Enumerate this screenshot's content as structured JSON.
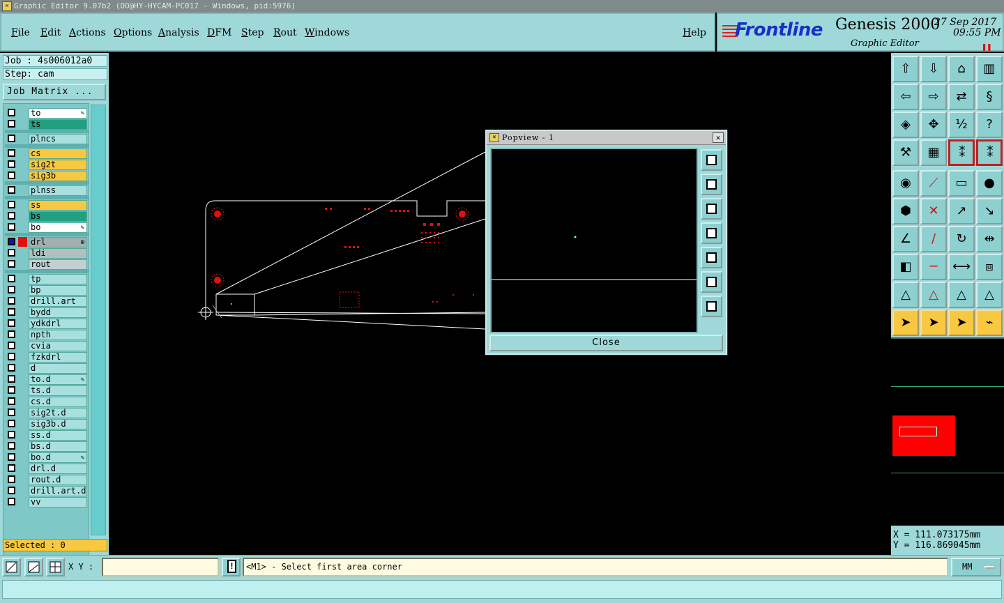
{
  "window": {
    "title": "Graphic Editor 9.07b2 (OO@HY-HYCAM-PC017 - Windows, pid:5976)"
  },
  "menu": [
    "File",
    "Edit",
    "Actions",
    "Options",
    "Analysis",
    "DFM",
    "Step",
    "Rout",
    "Windows"
  ],
  "help_label": "Help",
  "brand": {
    "logo": "Frontline",
    "product": "Genesis 2000",
    "subtitle": "Graphic Editor",
    "date": "27 Sep 2017",
    "time": "09:55 PM",
    "logo_color": "#1830c8",
    "stripe_color": "#e02020"
  },
  "job": {
    "job_line": "Job : 4s006012a0",
    "step_line": "Step: cam",
    "matrix_button": "Job Matrix ..."
  },
  "layers": [
    {
      "name": "to",
      "bg": "#ffffff",
      "mark": "✎"
    },
    {
      "name": "ts",
      "bg": "#20a080"
    },
    {
      "name": "plncs",
      "bg": "#a8e0e0"
    },
    {
      "name": "cs",
      "bg": "#f8c840"
    },
    {
      "name": "sig2t",
      "bg": "#f8c840"
    },
    {
      "name": "sig3b",
      "bg": "#f8c840"
    },
    {
      "name": "plnss",
      "bg": "#a8e0e0"
    },
    {
      "name": "ss",
      "bg": "#f8c840"
    },
    {
      "name": "bs",
      "bg": "#20a080"
    },
    {
      "name": "bo",
      "bg": "#ffffff",
      "mark": "✎"
    },
    {
      "name": "drl",
      "bg": "#a0b0b0",
      "mark": "⊞"
    },
    {
      "name": "ldi",
      "bg": "#b0c0c0"
    },
    {
      "name": "rout",
      "bg": "#c0d0d0"
    },
    {
      "name": "tp",
      "bg": "#a8e0e0"
    },
    {
      "name": "bp",
      "bg": "#a8e0e0"
    },
    {
      "name": "drill.art",
      "bg": "#a8e0e0"
    },
    {
      "name": "bydd",
      "bg": "#a8e0e0"
    },
    {
      "name": "ydkdrl",
      "bg": "#a8e0e0"
    },
    {
      "name": "npth",
      "bg": "#a8e0e0"
    },
    {
      "name": "cvia",
      "bg": "#a8e0e0"
    },
    {
      "name": "fzkdrl",
      "bg": "#a8e0e0"
    },
    {
      "name": "d",
      "bg": "#a8e0e0"
    },
    {
      "name": "to.d",
      "bg": "#a8e0e0",
      "mark": "✎"
    },
    {
      "name": "ts.d",
      "bg": "#a8e0e0"
    },
    {
      "name": "cs.d",
      "bg": "#a8e0e0"
    },
    {
      "name": "sig2t.d",
      "bg": "#a8e0e0"
    },
    {
      "name": "sig3b.d",
      "bg": "#a8e0e0"
    },
    {
      "name": "ss.d",
      "bg": "#a8e0e0"
    },
    {
      "name": "bs.d",
      "bg": "#a8e0e0"
    },
    {
      "name": "bo.d",
      "bg": "#a8e0e0",
      "mark": "✎"
    },
    {
      "name": "drl.d",
      "bg": "#a8e0e0"
    },
    {
      "name": "rout.d",
      "bg": "#a8e0e0"
    },
    {
      "name": "drill.art.d",
      "bg": "#a8e0e0"
    },
    {
      "name": "vv",
      "bg": "#a8e0e0"
    }
  ],
  "selected": "Selected : 0",
  "popview": {
    "title": "Popview - 1",
    "close_label": "Close",
    "close_x": "✕"
  },
  "coords": {
    "x": "X = 111.073175mm",
    "y": "Y = 116.869045mm"
  },
  "bottom": {
    "xy_label": "X Y :",
    "xy_value": "",
    "message": "<M1> - Select first area corner",
    "units": "MM",
    "alert_icon": "!"
  },
  "colors": {
    "panel": "#9ed8d8",
    "canvas": "#000000",
    "feature_red": "#e01010",
    "outline": "#ffffff"
  }
}
